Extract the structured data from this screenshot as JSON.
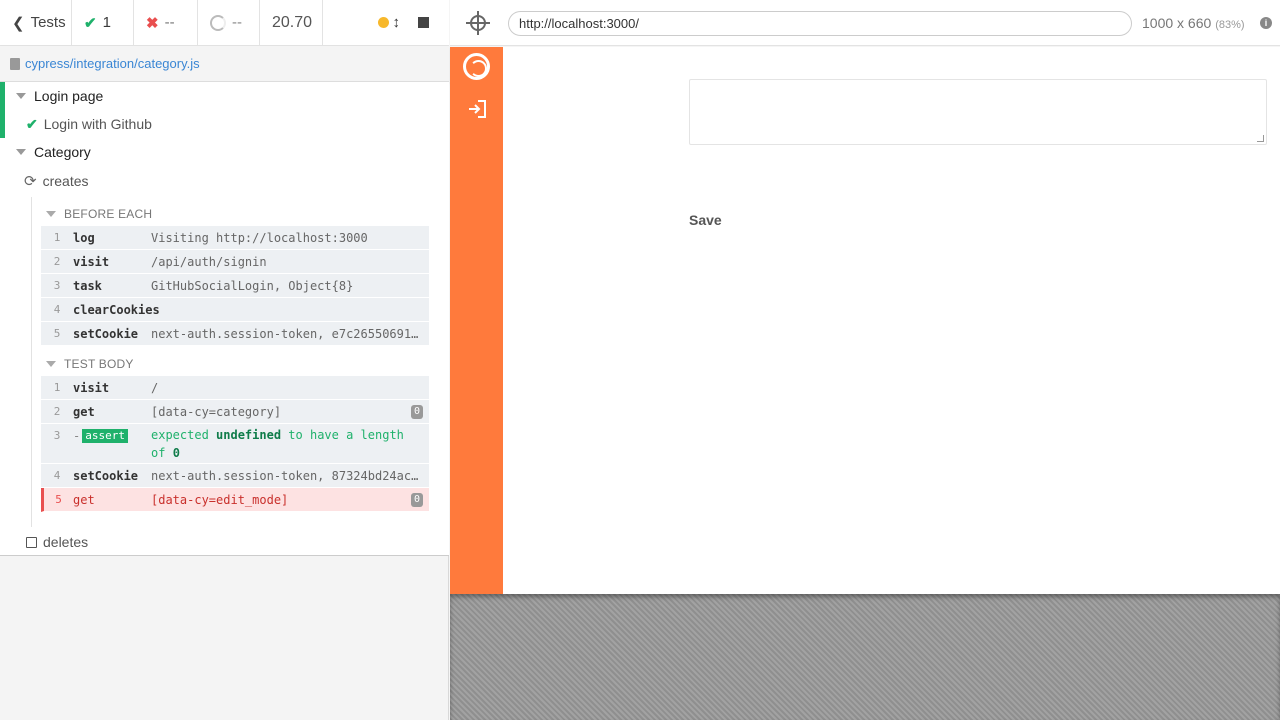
{
  "stats": {
    "tests_label": "Tests",
    "passed": "1",
    "failed": "--",
    "pending": "--",
    "duration": "20.70"
  },
  "spec": {
    "path": "cypress/integration/category.js"
  },
  "suites": {
    "login_page": "Login page",
    "login_test": "Login with Github",
    "category": "Category",
    "creates_test": "creates",
    "deletes_test": "deletes"
  },
  "before_each": {
    "header": "BEFORE EACH",
    "commands": [
      {
        "num": "1",
        "name": "log",
        "message": "Visiting http://localhost:3000"
      },
      {
        "num": "2",
        "name": "visit",
        "message": "/api/auth/signin"
      },
      {
        "num": "3",
        "name": "task",
        "message": "GitHubSocialLogin, Object{8}"
      },
      {
        "num": "4",
        "name": "clearCookies",
        "message": ""
      },
      {
        "num": "5",
        "name": "setCookie",
        "message": "next-auth.session-token, e7c26550691…"
      }
    ]
  },
  "test_body": {
    "header": "TEST BODY",
    "commands": [
      {
        "num": "1",
        "name": "visit",
        "message": "/"
      },
      {
        "num": "2",
        "name": "get",
        "message": "[data-cy=category]",
        "badge": "0"
      },
      {
        "num": "3",
        "name": "-",
        "tag": "assert",
        "msg_a": "expected",
        "msg_b": "undefined",
        "msg_c": "to have a length of",
        "msg_d": "0"
      },
      {
        "num": "4",
        "name": "setCookie",
        "message": "next-auth.session-token, 87324bd24ac…"
      },
      {
        "num": "5",
        "name": "get",
        "message": "[data-cy=edit_mode]",
        "badge": "0"
      }
    ]
  },
  "browser": {
    "url": "http://localhost:3000/",
    "viewport": "1000 x 660",
    "scale": "(83%)",
    "info_glyph": "i"
  },
  "app": {
    "save_label": "Save"
  },
  "colors": {
    "accent_orange": "#ff7a3c",
    "pass_green": "#1fb16b",
    "fail_red": "#e94f4f"
  }
}
